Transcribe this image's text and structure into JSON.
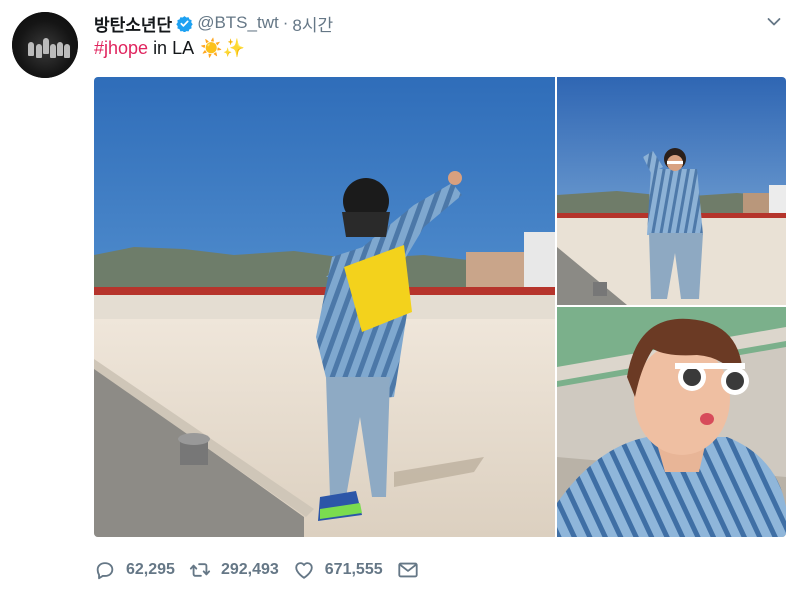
{
  "tweet": {
    "display_name": "방탄소년단",
    "handle": "@BTS_twt",
    "separator": "·",
    "time": "8시간",
    "hashtag": "#jhope",
    "text": "in LA",
    "emojis": "☀️✨"
  },
  "stats": {
    "replies": "62,295",
    "retweets": "292,493",
    "likes": "671,555"
  },
  "icons": {
    "verified": "verified-badge-icon",
    "more": "chevron-down-icon",
    "reply": "reply-icon",
    "retweet": "retweet-icon",
    "like": "heart-icon",
    "dm": "envelope-icon"
  },
  "colors": {
    "hashtag": "#e0245e",
    "verified": "#1da1f2",
    "muted": "#657786"
  }
}
